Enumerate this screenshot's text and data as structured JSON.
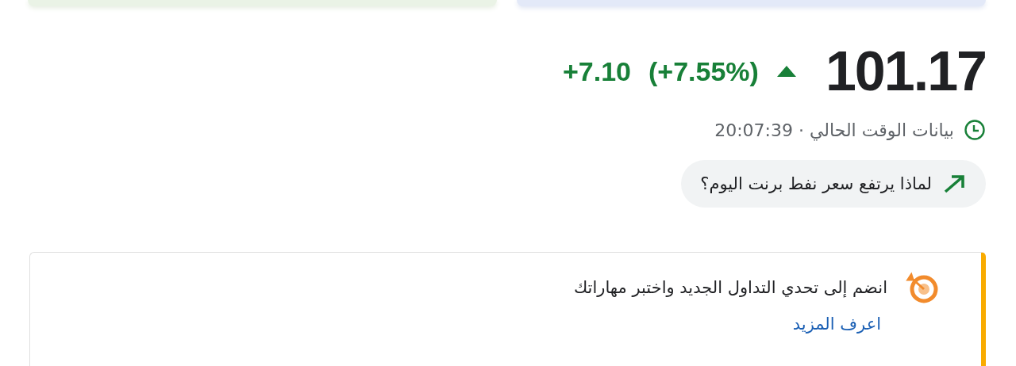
{
  "quote": {
    "price": "101.17",
    "rising": true,
    "change": "+7.10",
    "change_percent": "(+7.55%)"
  },
  "status": {
    "text": "بيانات الوقت الحالي · 20:07:39"
  },
  "question_chip": {
    "label": "لماذا يرتفع سعر نفط برنت اليوم؟"
  },
  "promo": {
    "text": "انضم إلى تحدي التداول الجديد واختبر مهاراتك",
    "link": "اعرف المزيد"
  }
}
